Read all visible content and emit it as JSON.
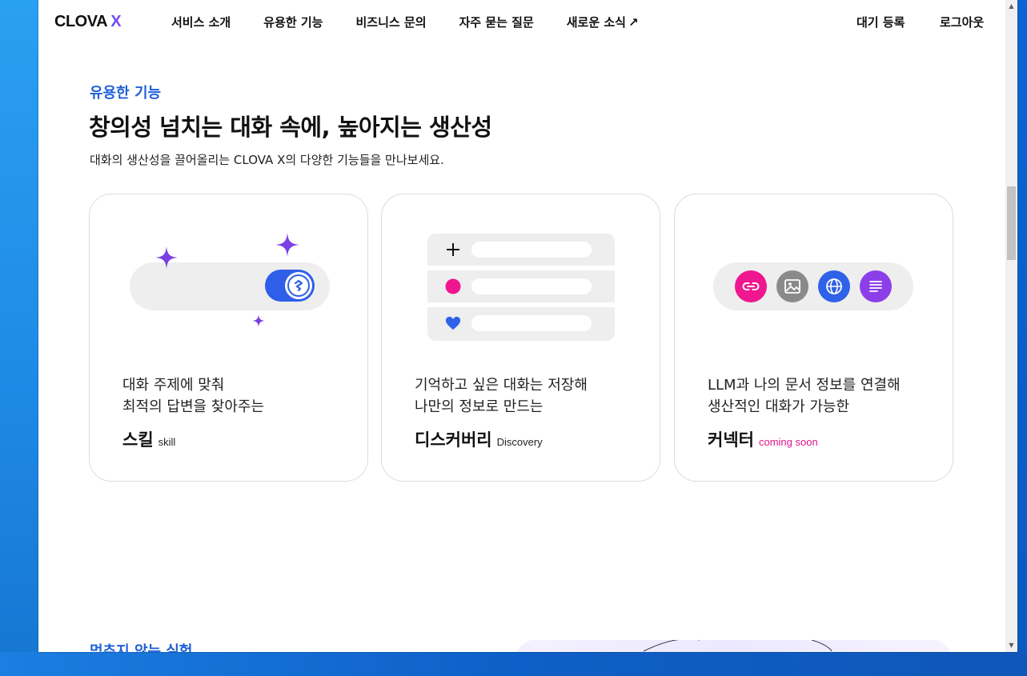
{
  "header": {
    "logo_text": "CLOVA",
    "logo_x": "X",
    "nav": [
      {
        "label": "서비스 소개"
      },
      {
        "label": "유용한 기능"
      },
      {
        "label": "비즈니스 문의"
      },
      {
        "label": "자주 묻는 질문"
      },
      {
        "label": "새로운 소식",
        "arrow": "↗"
      }
    ],
    "waitlist": "대기 등록",
    "logout": "로그아웃"
  },
  "section": {
    "eyebrow": "유용한 기능",
    "headline": "창의성 넘치는 대화 속에, 높아지는 생산성",
    "subline": "대화의 생산성을 끌어올리는 CLOVA X의 다양한 기능들을 만나보세요."
  },
  "cards": [
    {
      "desc_line1": "대화 주제에 맞춰",
      "desc_line2": "최적의 답변을 찾아주는",
      "name": "스킬",
      "sub": "skill",
      "icon": "skill-toggle-icon"
    },
    {
      "desc_line1": "기억하고 싶은 대화는 저장해",
      "desc_line2": "나만의 정보로 만드는",
      "name": "디스커버리",
      "sub": "Discovery",
      "icon": "discovery-list-icon"
    },
    {
      "desc_line1": "LLM과 나의 문서 정보를 연결해",
      "desc_line2": "생산적인 대화가 가능한",
      "name": "커넥터",
      "sub": "coming soon",
      "icon": "connector-icon"
    }
  ],
  "next_section": {
    "eyebrow": "멈추지 않는 실험"
  },
  "colors": {
    "accent_blue": "#1f5fd6",
    "toggle_blue": "#2f5fe8",
    "sparkle_purple": "#7b3fe4",
    "pink": "#f0168f",
    "gray": "#8a8a8a",
    "globe_blue": "#2f62e8",
    "doc_purple": "#8c3fe8",
    "coming_soon": "#e0168a"
  }
}
